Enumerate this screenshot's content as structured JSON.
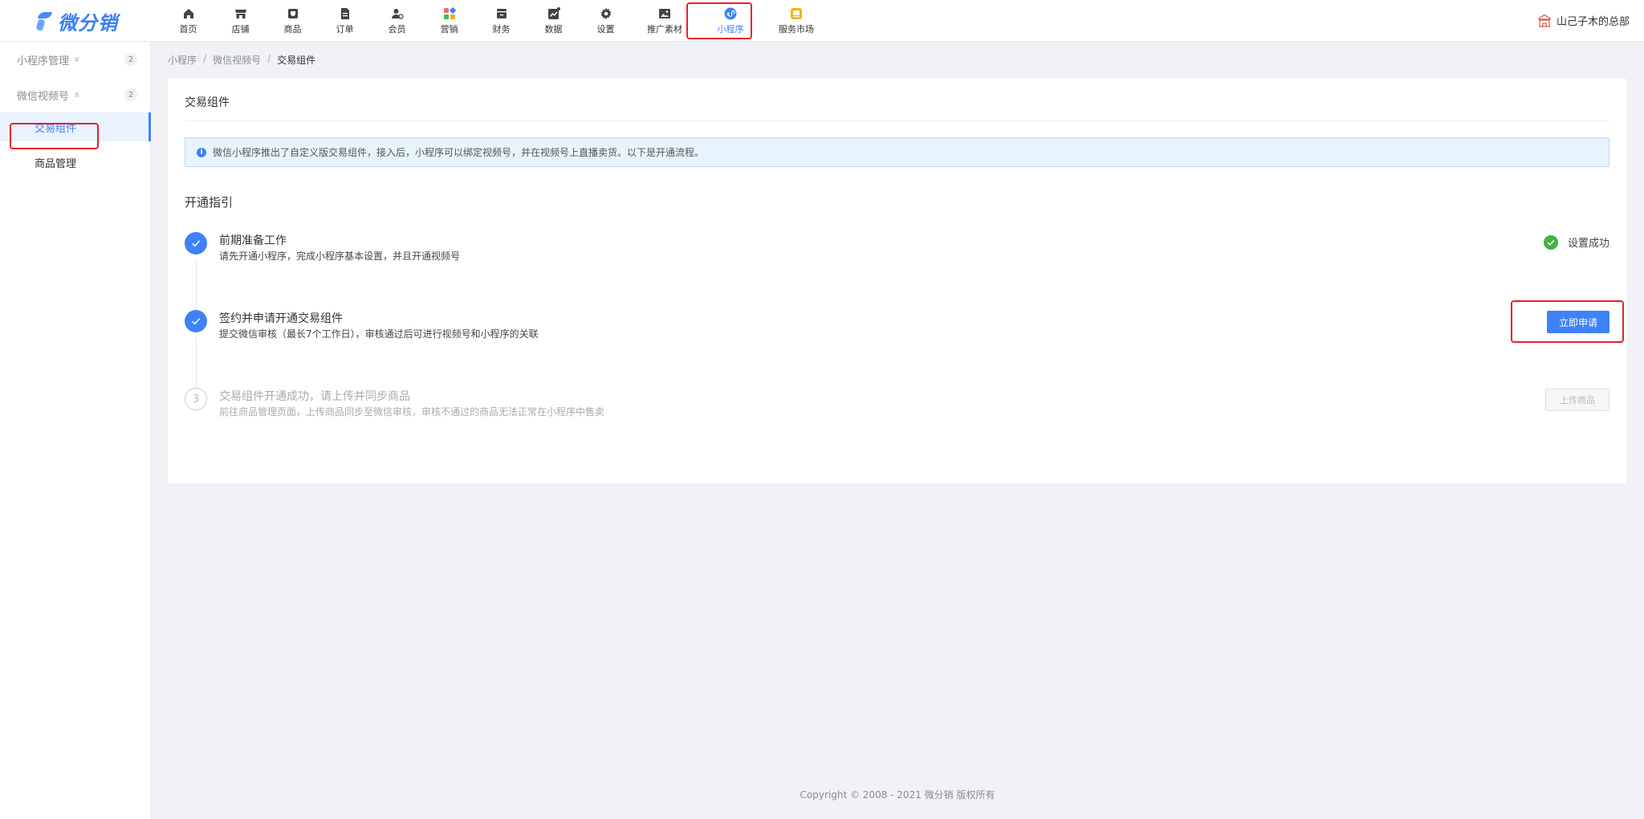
{
  "brand": {
    "name": "微分销"
  },
  "nav": {
    "items": [
      {
        "label": "首页",
        "icon": "home-icon"
      },
      {
        "label": "店铺",
        "icon": "store-icon"
      },
      {
        "label": "商品",
        "icon": "goods-icon"
      },
      {
        "label": "订单",
        "icon": "order-icon"
      },
      {
        "label": "会员",
        "icon": "member-icon"
      },
      {
        "label": "营销",
        "icon": "marketing-icon"
      },
      {
        "label": "财务",
        "icon": "finance-icon"
      },
      {
        "label": "数据",
        "icon": "data-icon"
      },
      {
        "label": "设置",
        "icon": "gear-icon"
      },
      {
        "label": "推广素材",
        "icon": "image-icon"
      },
      {
        "label": "小程序",
        "icon": "mini-program-icon"
      },
      {
        "label": "服务市场",
        "icon": "market-icon"
      }
    ],
    "active_color": "#3e82f7"
  },
  "user": {
    "name": "山己子木的总部"
  },
  "sidebar": {
    "groups": [
      {
        "label": "小程序管理",
        "badge": "2",
        "chevron": "chevron-down-icon"
      },
      {
        "label": "微信视频号",
        "badge": "2",
        "chevron": "chevron-up-icon"
      }
    ],
    "items": [
      {
        "label": "交易组件",
        "active": true
      },
      {
        "label": "商品管理",
        "active": false
      }
    ]
  },
  "breadcrumb": [
    "小程序",
    "微信视频号",
    "交易组件"
  ],
  "panel": {
    "title": "交易组件",
    "notice": "微信小程序推出了自定义版交易组件，接入后，小程序可以绑定视频号，并在视频号上直播卖货。以下是开通流程。",
    "section_title": "开通指引",
    "steps": [
      {
        "title": "前期准备工作",
        "desc": "请先开通小程序，完成小程序基本设置，并且开通视频号",
        "status": "设置成功"
      },
      {
        "title": "签约并申请开通交易组件",
        "desc": "提交微信审核（最长7个工作日），审核通过后可进行视频号和小程序的关联",
        "action": "立即申请"
      },
      {
        "number": "3",
        "title": "交易组件开通成功，请上传并同步商品",
        "desc": "前往商品管理页面，上传商品同步至微信审核，审核不通过的商品无法正常在小程序中售卖",
        "action": "上传商品"
      }
    ]
  },
  "footer": {
    "copyright": "Copyright © 2008 - 2021 微分销 版权所有"
  }
}
